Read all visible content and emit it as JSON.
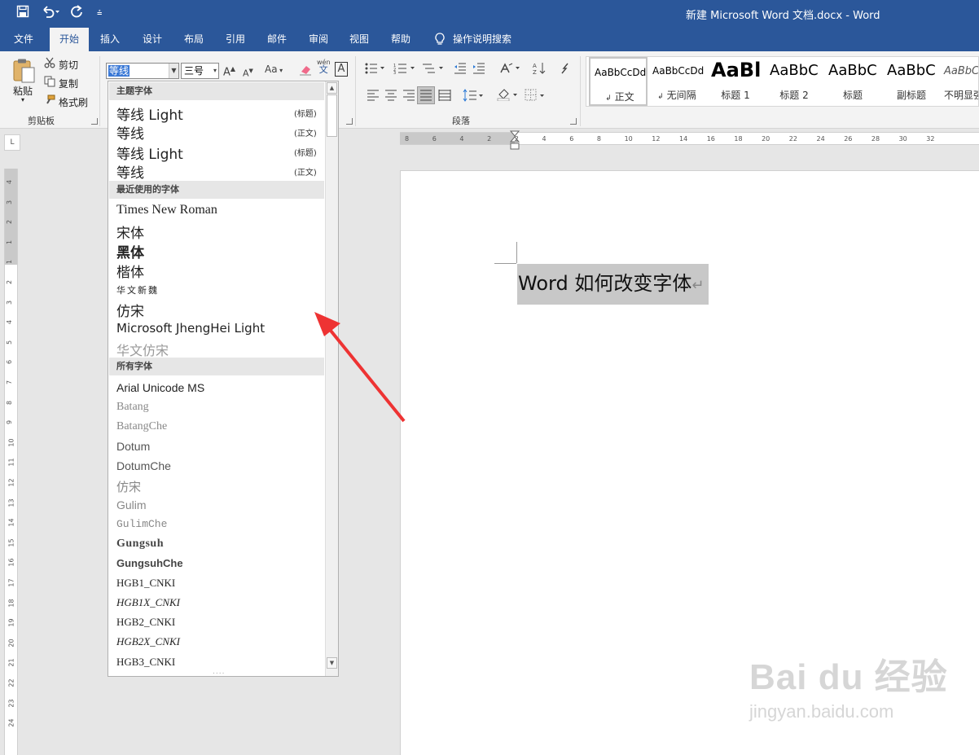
{
  "window": {
    "title": "新建 Microsoft Word 文档.docx  -  Word",
    "quick_access": [
      "save-icon",
      "undo-icon",
      "redo-icon",
      "customize-icon"
    ]
  },
  "tabs": {
    "file": "文件",
    "home": "开始",
    "insert": "插入",
    "design": "设计",
    "layout": "布局",
    "references": "引用",
    "mailings": "邮件",
    "review": "审阅",
    "view": "视图",
    "help": "帮助",
    "tell_me": "操作说明搜索"
  },
  "clipboard": {
    "paste": "粘贴",
    "cut": "剪切",
    "copy": "复制",
    "format_painter": "格式刷",
    "group_label": "剪贴板"
  },
  "font": {
    "current_font": "等线",
    "current_size": "三号",
    "grow": "A",
    "shrink": "A",
    "case": "Aa",
    "phonetic_top": "wén",
    "phonetic_bottom": "文",
    "char_border": "A"
  },
  "paragraph": {
    "group_label": "段落"
  },
  "styles": [
    {
      "preview": "AaBbCcDd",
      "name": "正文",
      "mark": "↲"
    },
    {
      "preview": "AaBbCcDd",
      "name": "无间隔",
      "mark": "↲"
    },
    {
      "preview": "AaBl",
      "name": "标题 1",
      "mark": ""
    },
    {
      "preview": "AaBbC",
      "name": "标题 2",
      "mark": ""
    },
    {
      "preview": "AaBbC",
      "name": "标题",
      "mark": ""
    },
    {
      "preview": "AaBbC",
      "name": "副标题",
      "mark": ""
    },
    {
      "preview": "AaBbCc",
      "name": "不明显强",
      "mark": ""
    }
  ],
  "ruler": {
    "h_ticks": [
      "8",
      "6",
      "4",
      "2",
      "2",
      "4",
      "6",
      "8",
      "10",
      "12",
      "14",
      "16",
      "18",
      "20",
      "22",
      "24",
      "26",
      "28",
      "30",
      "32"
    ],
    "v_ticks": [
      "4",
      "3",
      "2",
      "1",
      "1",
      "2",
      "3",
      "4",
      "5",
      "6",
      "7",
      "8",
      "9",
      "10",
      "11",
      "12",
      "13",
      "14",
      "15",
      "16",
      "17",
      "18",
      "19",
      "20",
      "21",
      "22",
      "23",
      "24"
    ],
    "tab_selector": "L"
  },
  "document": {
    "text": "Word 如何改变字体",
    "paragraph_mark": "↵"
  },
  "font_dropdown": {
    "theme_header": "主题字体",
    "theme_fonts": [
      {
        "name": "等线 Light",
        "tag": "(标题)"
      },
      {
        "name": "等线",
        "tag": "(正文)"
      },
      {
        "name": "等线 Light",
        "tag": "(标题)"
      },
      {
        "name": "等线",
        "tag": "(正文)"
      }
    ],
    "recent_header": "最近使用的字体",
    "recent_fonts": [
      "Times New Roman",
      "宋体",
      "黑体",
      "楷体",
      "华文新魏",
      "仿宋",
      "Microsoft JhengHei Light",
      "华文仿宋"
    ],
    "all_header": "所有字体",
    "all_fonts": [
      "Arial Unicode MS",
      "Batang",
      "BatangChe",
      "Dotum",
      "DotumChe",
      "仿宋",
      "Gulim",
      "GulimChe",
      "Gungsuh",
      "GungsuhChe",
      "HGB1_CNKI",
      "HGB1X_CNKI",
      "HGB2_CNKI",
      "HGB2X_CNKI",
      "HGB3_CNKI"
    ],
    "grip": "....",
    "scroll_up": "▲",
    "scroll_down": "▼"
  },
  "watermark": {
    "brand": "Bai du 经验",
    "url": "jingyan.baidu.com"
  },
  "colors": {
    "title_bar": "#2b579a",
    "ribbon": "#f3f3f3",
    "selection": "#c8c8c8",
    "font_selection": "#3b79d6",
    "arrow": "#ee3333"
  }
}
